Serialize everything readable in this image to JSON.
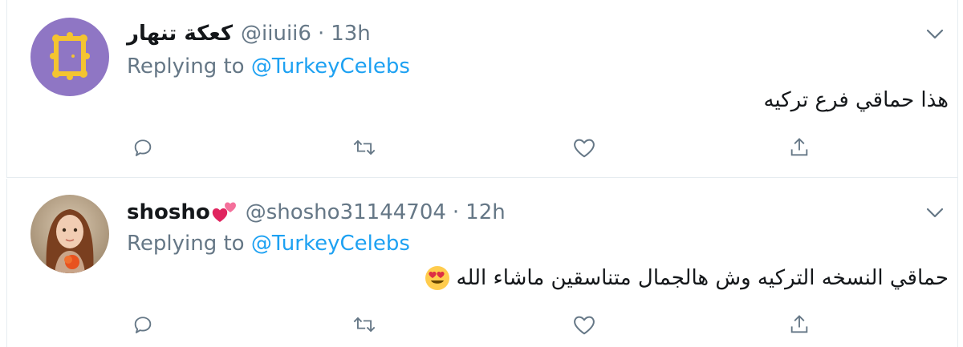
{
  "colors": {
    "link": "#1da1f2",
    "secondary_text": "#657786",
    "primary_text": "#14171a",
    "divider": "#e6ecf0",
    "avatar1_bg": "#8f76c4"
  },
  "tweets": [
    {
      "display_name": "كعكة تنهار",
      "handle": "@iiuii6",
      "separator": "·",
      "time": "13h",
      "replying_prefix": "Replying to",
      "replying_handle": "@TurkeyCelebs",
      "text": "هذا حماقي فرع تركيه",
      "avatar": "frame-logo-avatar",
      "icons": [
        "reply-icon",
        "retweet-icon",
        "like-icon",
        "share-icon",
        "chevron-down-icon"
      ]
    },
    {
      "display_name": "shosho",
      "name_emoji": "two-hearts-emoji",
      "handle": "@shosho31144704",
      "separator": "·",
      "time": "12h",
      "replying_prefix": "Replying to",
      "replying_handle": "@TurkeyCelebs",
      "text": "حماقي النسخه التركيه وش هالجمال متناسقين ماشاء الله",
      "text_emoji": "heart-eyes-emoji",
      "avatar": "girl-photo-avatar",
      "icons": [
        "reply-icon",
        "retweet-icon",
        "like-icon",
        "share-icon",
        "chevron-down-icon"
      ]
    }
  ]
}
